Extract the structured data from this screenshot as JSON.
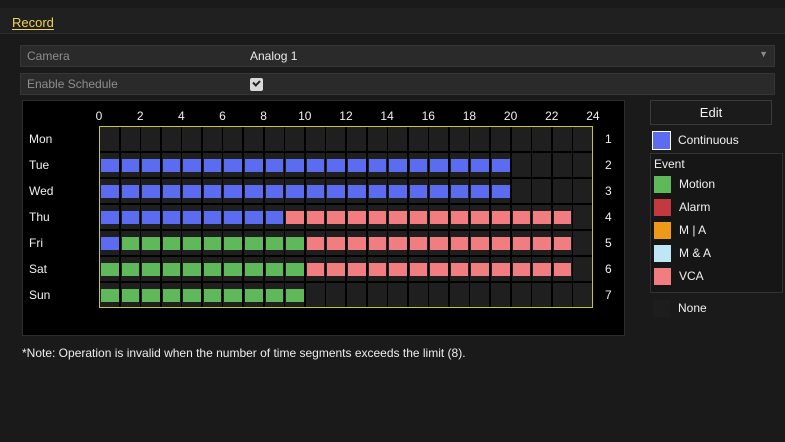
{
  "tab": {
    "label": "Record"
  },
  "camera": {
    "label": "Camera",
    "value": "Analog 1"
  },
  "schedule_toggle": {
    "label": "Enable Schedule",
    "checked": true
  },
  "grid": {
    "hour_labels": [
      "0",
      "2",
      "4",
      "6",
      "8",
      "10",
      "12",
      "14",
      "16",
      "18",
      "20",
      "22",
      "24"
    ],
    "days": [
      {
        "label": "Mon",
        "num": "1",
        "segments": []
      },
      {
        "label": "Tue",
        "num": "2",
        "segments": [
          {
            "start": 0,
            "end": 20,
            "type": "continuous"
          }
        ]
      },
      {
        "label": "Wed",
        "num": "3",
        "segments": [
          {
            "start": 0,
            "end": 20,
            "type": "continuous"
          }
        ]
      },
      {
        "label": "Thu",
        "num": "4",
        "segments": [
          {
            "start": 0,
            "end": 9,
            "type": "continuous"
          },
          {
            "start": 9,
            "end": 23,
            "type": "alarm"
          }
        ]
      },
      {
        "label": "Fri",
        "num": "5",
        "segments": [
          {
            "start": 0,
            "end": 1,
            "type": "continuous"
          },
          {
            "start": 1,
            "end": 10,
            "type": "motion"
          },
          {
            "start": 10,
            "end": 23,
            "type": "alarm"
          }
        ]
      },
      {
        "label": "Sat",
        "num": "6",
        "segments": [
          {
            "start": 0,
            "end": 10,
            "type": "motion"
          },
          {
            "start": 10,
            "end": 23,
            "type": "alarm"
          }
        ]
      },
      {
        "label": "Sun",
        "num": "7",
        "segments": [
          {
            "start": 0,
            "end": 10,
            "type": "motion"
          }
        ]
      }
    ]
  },
  "sidebar": {
    "edit_label": "Edit",
    "continuous_label": "Continuous",
    "event_heading": "Event",
    "events": [
      {
        "key": "motion",
        "label": "Motion"
      },
      {
        "key": "alarm",
        "label": "Alarm"
      },
      {
        "key": "m_or_a",
        "label": "M | A"
      },
      {
        "key": "m_and_a",
        "label": "M & A"
      },
      {
        "key": "vca",
        "label": "VCA"
      }
    ],
    "none_label": "None"
  },
  "colors": {
    "continuous": "#5b6cf0",
    "motion": "#5fb85a",
    "alarm": "#f27d80",
    "alarm_legend": "#c2393f",
    "m_or_a": "#ec9a18",
    "m_and_a": "#bfe6f7",
    "vca": "#f27d80",
    "none": "#1d1d1d"
  },
  "note": "*Note: Operation is invalid when the number of time segments exceeds the limit (8)."
}
